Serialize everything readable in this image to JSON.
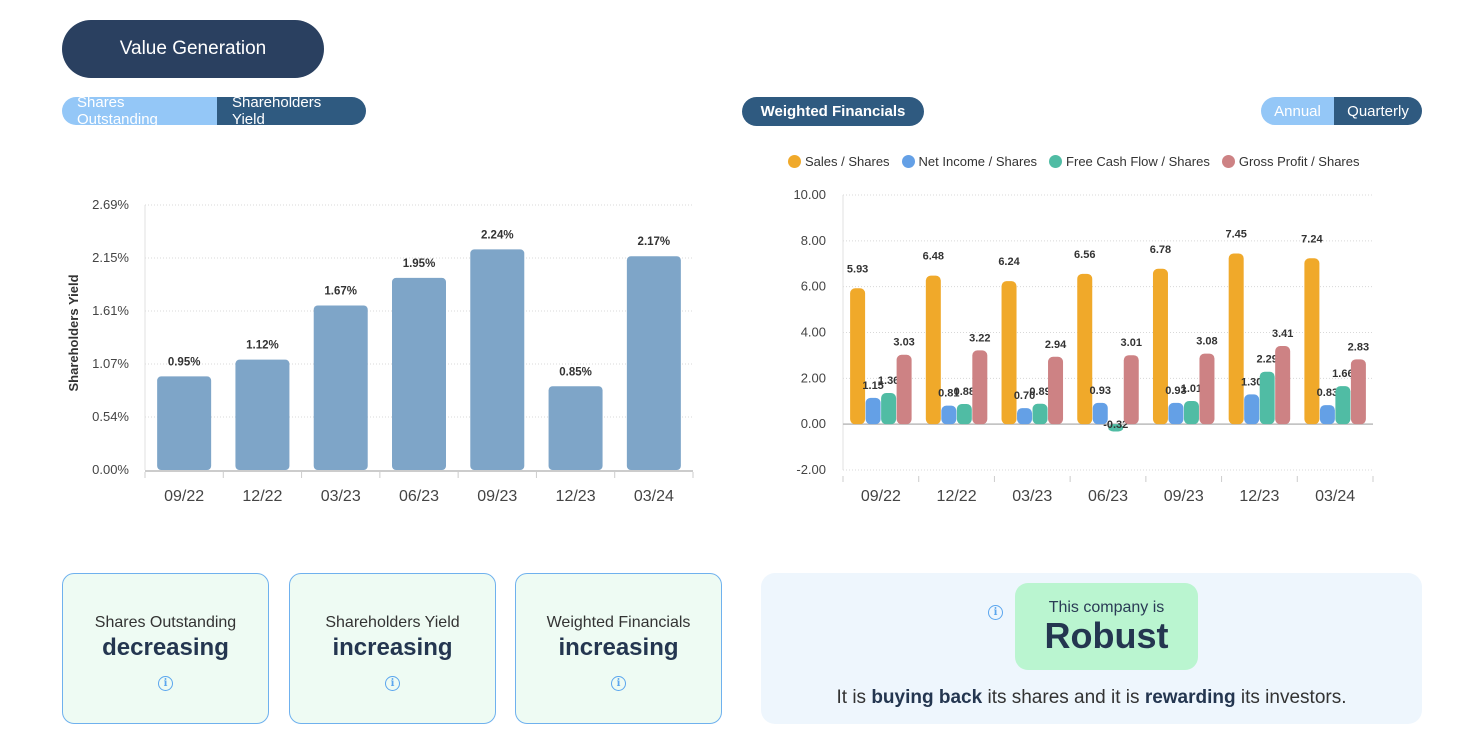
{
  "header": {
    "title": "Value Generation"
  },
  "left_toggle": {
    "options": [
      "Shares Outstanding",
      "Shareholders Yield"
    ],
    "selected": "Shareholders Yield"
  },
  "right_header": {
    "title": "Weighted Financials"
  },
  "period_toggle": {
    "options": [
      "Annual",
      "Quarterly"
    ],
    "selected": "Quarterly"
  },
  "chart_data": [
    {
      "type": "bar",
      "title": "",
      "xlabel": "",
      "ylabel": "Shareholders Yield",
      "categories": [
        "09/22",
        "12/22",
        "03/23",
        "06/23",
        "09/23",
        "12/23",
        "03/24"
      ],
      "values": [
        0.95,
        1.12,
        1.67,
        1.95,
        2.24,
        0.85,
        2.17
      ],
      "value_labels": [
        "0.95%",
        "1.12%",
        "1.67%",
        "1.95%",
        "2.24%",
        "0.85%",
        "2.17%"
      ],
      "yticks": [
        "0.00%",
        "0.54%",
        "1.07%",
        "1.61%",
        "2.15%",
        "2.69%"
      ],
      "ytick_values": [
        0,
        0.538,
        1.076,
        1.614,
        2.152,
        2.69
      ],
      "ylim": [
        0,
        2.69
      ],
      "grid": true,
      "color": "#7ea5c8"
    },
    {
      "type": "bar",
      "title": "Weighted Financials",
      "xlabel": "",
      "ylabel": "",
      "categories": [
        "09/22",
        "12/22",
        "03/23",
        "06/23",
        "09/23",
        "12/23",
        "03/24"
      ],
      "series": [
        {
          "name": "Sales / Shares",
          "color": "#f0a92a",
          "values": [
            5.93,
            6.48,
            6.24,
            6.56,
            6.78,
            7.45,
            7.24
          ]
        },
        {
          "name": "Net Income / Shares",
          "color": "#64a0e6",
          "values": [
            1.15,
            0.81,
            0.7,
            0.93,
            0.93,
            1.3,
            0.83
          ]
        },
        {
          "name": "Free Cash Flow / Shares",
          "color": "#50bca4",
          "values": [
            1.36,
            0.88,
            0.89,
            -0.32,
            1.01,
            2.29,
            1.66
          ]
        },
        {
          "name": "Gross Profit / Shares",
          "color": "#cd8284",
          "values": [
            3.03,
            3.22,
            2.94,
            3.01,
            3.08,
            3.41,
            2.83
          ]
        }
      ],
      "yticks": [
        "-2.00",
        "0.00",
        "2.00",
        "4.00",
        "6.00",
        "8.00",
        "10.00"
      ],
      "ytick_values": [
        -2,
        0,
        2,
        4,
        6,
        8,
        10
      ],
      "ylim": [
        -2,
        10
      ],
      "grid": true,
      "legend": "top"
    }
  ],
  "cards": [
    {
      "label": "Shares Outstanding",
      "value": "decreasing"
    },
    {
      "label": "Shareholders Yield",
      "value": "increasing"
    },
    {
      "label": "Weighted Financials",
      "value": "increasing"
    }
  ],
  "info_glyph": "i",
  "summary": {
    "pre": "This company is",
    "verdict": "Robust",
    "text_parts": [
      "It is ",
      "buying back",
      " its shares and it is ",
      "rewarding",
      " its investors."
    ]
  }
}
